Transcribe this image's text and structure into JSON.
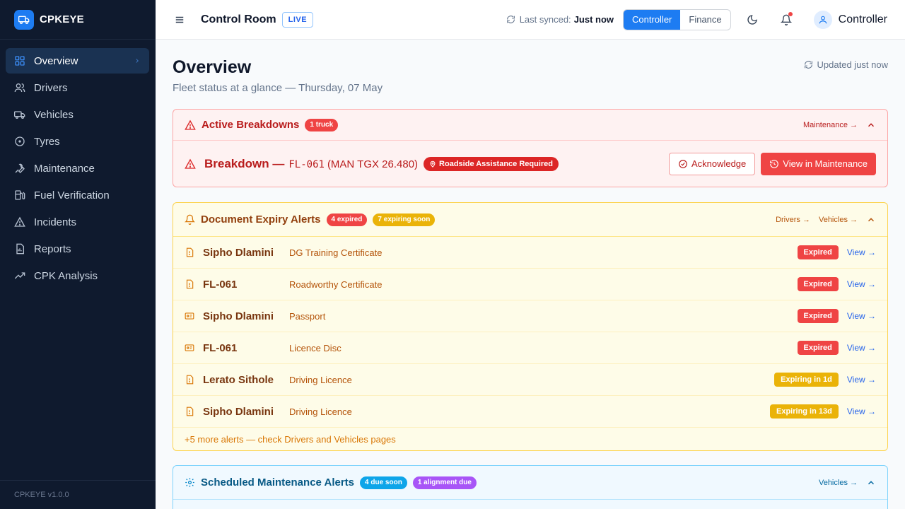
{
  "brand": {
    "name": "CPKEYE",
    "version": "CPKEYE v1.0.0"
  },
  "sidebar": {
    "items": [
      {
        "label": "Overview",
        "icon": "grid-icon",
        "active": true
      },
      {
        "label": "Drivers",
        "icon": "users-icon"
      },
      {
        "label": "Vehicles",
        "icon": "truck-icon"
      },
      {
        "label": "Tyres",
        "icon": "tyre-icon"
      },
      {
        "label": "Maintenance",
        "icon": "wrench-icon"
      },
      {
        "label": "Fuel Verification",
        "icon": "fuel-icon"
      },
      {
        "label": "Incidents",
        "icon": "warning-icon"
      },
      {
        "label": "Reports",
        "icon": "report-icon"
      },
      {
        "label": "CPK Analysis",
        "icon": "trend-icon"
      }
    ]
  },
  "header": {
    "title": "Control Room",
    "live": "LIVE",
    "sync_label": "Last synced:",
    "sync_value": "Just now",
    "modes": [
      "Controller",
      "Finance"
    ],
    "active_mode": "Controller",
    "user": "Controller"
  },
  "page": {
    "title": "Overview",
    "subtitle": "Fleet status at a glance — Thursday, 07 May",
    "updated": "Updated just now"
  },
  "breakdowns": {
    "title": "Active Breakdowns",
    "count": "1 truck",
    "link": "Maintenance →",
    "item": {
      "label": "Breakdown —",
      "vehicle": "FL-061",
      "model": "(MAN TGX 26.480)",
      "tag": "Roadside Assistance Required",
      "ack": "Acknowledge",
      "view": "View in Maintenance"
    }
  },
  "documents": {
    "title": "Document Expiry Alerts",
    "expired": "4 expired",
    "soon": "7 expiring soon",
    "links": [
      "Drivers →",
      "Vehicles →"
    ],
    "rows": [
      {
        "name": "Sipho Dlamini",
        "doc": "DG Training Certificate",
        "status": "Expired",
        "kind": "exp",
        "icon": "document-alert-icon",
        "link": "View →"
      },
      {
        "name": "FL-061",
        "doc": "Roadworthy Certificate",
        "status": "Expired",
        "kind": "exp",
        "icon": "document-alert-icon",
        "link": "View →"
      },
      {
        "name": "Sipho Dlamini",
        "doc": "Passport",
        "status": "Expired",
        "kind": "exp",
        "icon": "id-card-icon",
        "link": "View →"
      },
      {
        "name": "FL-061",
        "doc": "Licence Disc",
        "status": "Expired",
        "kind": "exp",
        "icon": "id-card-icon",
        "link": "View →"
      },
      {
        "name": "Lerato Sithole",
        "doc": "Driving Licence",
        "status": "Expiring in 1d",
        "kind": "soon",
        "icon": "document-alert-icon",
        "link": "View →"
      },
      {
        "name": "Sipho Dlamini",
        "doc": "Driving Licence",
        "status": "Expiring in 13d",
        "kind": "soon",
        "icon": "document-alert-icon",
        "link": "View →"
      }
    ],
    "more": "+5 more alerts — check Drivers and Vehicles pages"
  },
  "maintenance": {
    "title": "Scheduled Maintenance Alerts",
    "due": "4 due soon",
    "alignment": "1 alignment due",
    "link": "Vehicles →"
  },
  "colors": {
    "accent": "#1d7cf2",
    "danger": "#ef4444",
    "warning": "#eab308",
    "info": "#0ea5e9",
    "purple": "#a855f7",
    "sidebar_bg": "#0f1a2e"
  }
}
